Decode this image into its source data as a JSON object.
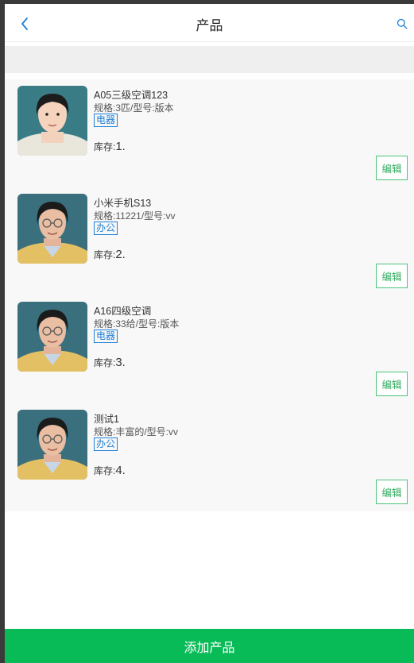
{
  "header": {
    "title": "产品",
    "back_icon": "chevron-left-icon",
    "search_icon": "search-icon",
    "accent": "#1e7ed6"
  },
  "products": [
    {
      "name": "A05三级空调123",
      "spec": "规格:3匹/型号:版本",
      "tag": "电器",
      "stock_label": "库存:",
      "stock_value": "1.",
      "edit_label": "编辑"
    },
    {
      "name": "小米手机S13",
      "spec": "规格:11221/型号:vv",
      "tag": "办公",
      "stock_label": "库存:",
      "stock_value": "2.",
      "edit_label": "编辑"
    },
    {
      "name": "A16四级空调",
      "spec": "规格:33给/型号:版本",
      "tag": "电器",
      "stock_label": "库存:",
      "stock_value": "3.",
      "edit_label": "编辑"
    },
    {
      "name": "测试1",
      "spec": "规格:丰富的/型号:vv",
      "tag": "办公",
      "stock_label": "库存:",
      "stock_value": "4.",
      "edit_label": "编辑"
    }
  ],
  "footer": {
    "add_label": "添加产品",
    "color": "#09bb57"
  }
}
